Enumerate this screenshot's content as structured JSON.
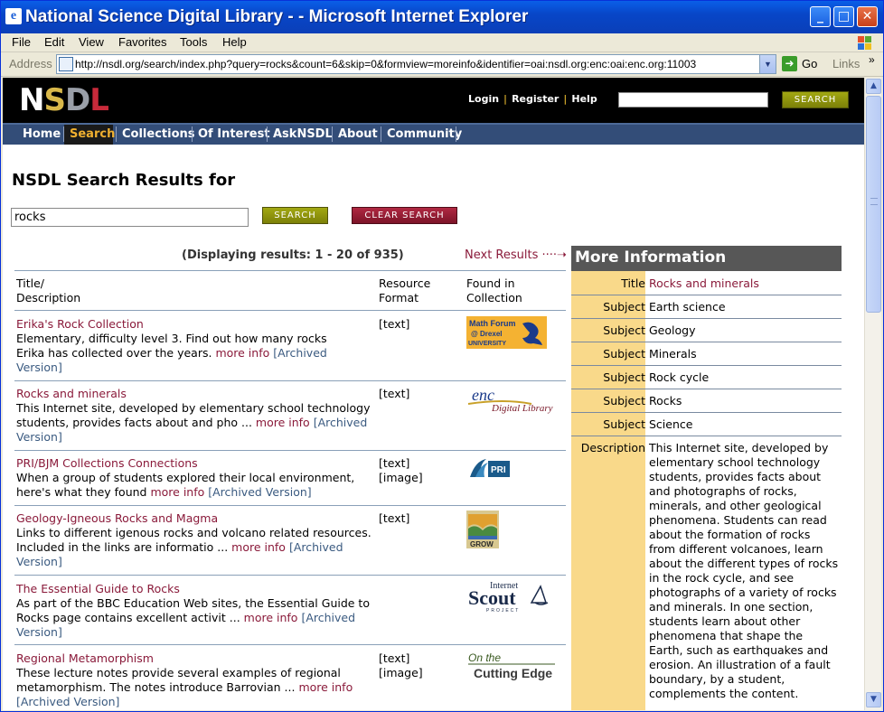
{
  "window": {
    "title": "National Science Digital Library - - Microsoft Internet Explorer",
    "buttons": {
      "minimize": "_",
      "maximize": "□",
      "close": "✕"
    }
  },
  "menu": [
    "File",
    "Edit",
    "View",
    "Favorites",
    "Tools",
    "Help"
  ],
  "address": {
    "label": "Address",
    "url": "http://nsdl.org/search/index.php?query=rocks&count=6&skip=0&formview=moreinfo&identifier=oai:nsdl.org:enc:oai:enc.org:11003",
    "go": "Go",
    "links": "Links",
    "chevron": "»"
  },
  "site": {
    "logo": [
      "N",
      "S",
      "D",
      "L"
    ],
    "toplinks": [
      "Login",
      "Register",
      "Help"
    ],
    "top_search_button": "SEARCH",
    "nav": [
      "Home",
      "Search",
      "Collections",
      "Of Interest",
      "AskNSDL",
      "About",
      "Community"
    ],
    "active_nav": "Search"
  },
  "search": {
    "heading": "NSDL Search Results for",
    "query": "rocks",
    "search_button": "SEARCH",
    "clear_button": "CLEAR SEARCH"
  },
  "results": {
    "displaying": "(Displaying results: 1 - 20 of 935)",
    "next": "Next Results",
    "headers": {
      "title": [
        "Title/",
        "Description"
      ],
      "format": [
        "Resource",
        "Format"
      ],
      "collection": [
        "Found in",
        "Collection"
      ]
    },
    "more_info_label": "more info",
    "archived_label": "[Archived Version]",
    "items": [
      {
        "title": "Erika's Rock Collection",
        "desc": "Elementary, difficulty level 3. Find out how many rocks Erika has collected over the years.",
        "format": "[text]",
        "collection_logo": "Math Forum @ Drexel University"
      },
      {
        "title": "Rocks and minerals",
        "desc": "This Internet site, developed by elementary school technology students, provides facts about and pho ...",
        "format": "[text]",
        "collection_logo": "enc Digital Library"
      },
      {
        "title": "PRI/BJM Collections Connections",
        "desc": "When a group of students explored their local environment, here's what they found",
        "format": "[text]\n[image]",
        "collection_logo": "PRI"
      },
      {
        "title": "Geology-Igneous Rocks and Magma",
        "desc": "Links to different igenous rocks and volcano related resources. Included in the links are informatio ...",
        "format": "[text]",
        "collection_logo": "GROW"
      },
      {
        "title": "The Essential Guide to Rocks",
        "desc": "As part of the BBC Education Web sites, the Essential Guide to Rocks page contains excellent activit ...",
        "format": "",
        "collection_logo": "Internet Scout Project"
      },
      {
        "title": "Regional Metamorphism",
        "desc": "These lecture notes provide several examples of regional metamorphism. The notes introduce Barrovian ...",
        "format": "[text]\n[image]",
        "collection_logo": "On the Cutting Edge"
      }
    ]
  },
  "more_info": {
    "heading": "More Information",
    "rows": [
      {
        "label": "Title",
        "value": "Rocks and minerals"
      },
      {
        "label": "Subject",
        "value": "Earth science"
      },
      {
        "label": "Subject",
        "value": "Geology"
      },
      {
        "label": "Subject",
        "value": "Minerals"
      },
      {
        "label": "Subject",
        "value": "Rock cycle"
      },
      {
        "label": "Subject",
        "value": "Rocks"
      },
      {
        "label": "Subject",
        "value": "Science"
      }
    ],
    "description_label": "Description",
    "description": "This Internet site, developed by elementary school technology students, provides facts about and photographs of rocks, minerals, and other geological phenomena. Students can read about the formation of rocks from different volcanoes, learn about the different types of rocks in the rock cycle, and see photographs of a variety of rocks and minerals. In one section, students learn about other phenomena that shape the Earth, such as earthquakes and erosion. An illustration of a fault boundary, by a student, complements the content."
  },
  "colors": {
    "link": "#8a1a3a",
    "nav_bg": "#334d78",
    "olive_button": "#8c9010",
    "red_button": "#9a1e34",
    "label_col": "#f9d98a"
  }
}
